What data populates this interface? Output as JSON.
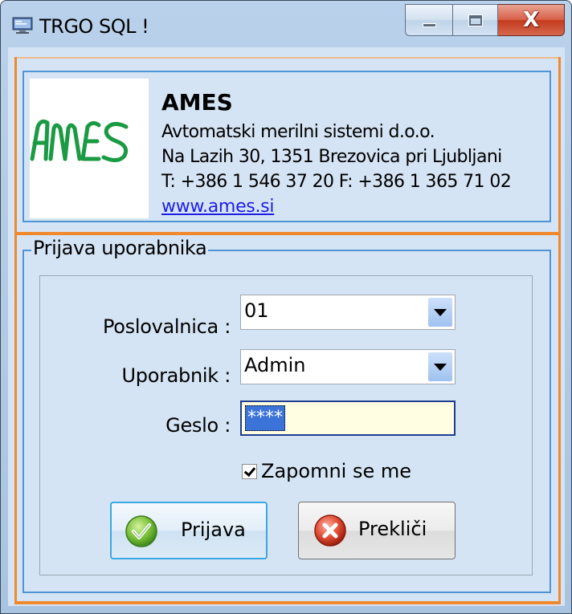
{
  "window": {
    "title": "TRGO SQL !",
    "close_glyph": "X",
    "accent_color": "#f0892c",
    "frame_color": "#b9d1ea"
  },
  "company": {
    "logo_text": "AMES",
    "name": "AMES",
    "description": "Avtomatski merilni sistemi d.o.o.",
    "address": "Na Lazih 30, 1351 Brezovica pri Ljubljani",
    "phone_fax": "T: +386 1 546 37 20 F: +386 1 365 71 02",
    "website": "www.ames.si"
  },
  "login": {
    "group_title": "Prijava uporabnika",
    "branch_label": "Poslovalnica :",
    "branch_value": "01",
    "user_label": "Uporabnik :",
    "user_value": "Admin",
    "password_label": "Geslo :",
    "password_value": "****",
    "remember_label": "Zapomni se me",
    "remember_checked": true,
    "login_button": "Prijava",
    "cancel_button": "Prekliči",
    "icons": {
      "login": "check-icon",
      "cancel": "cancel-icon"
    }
  }
}
